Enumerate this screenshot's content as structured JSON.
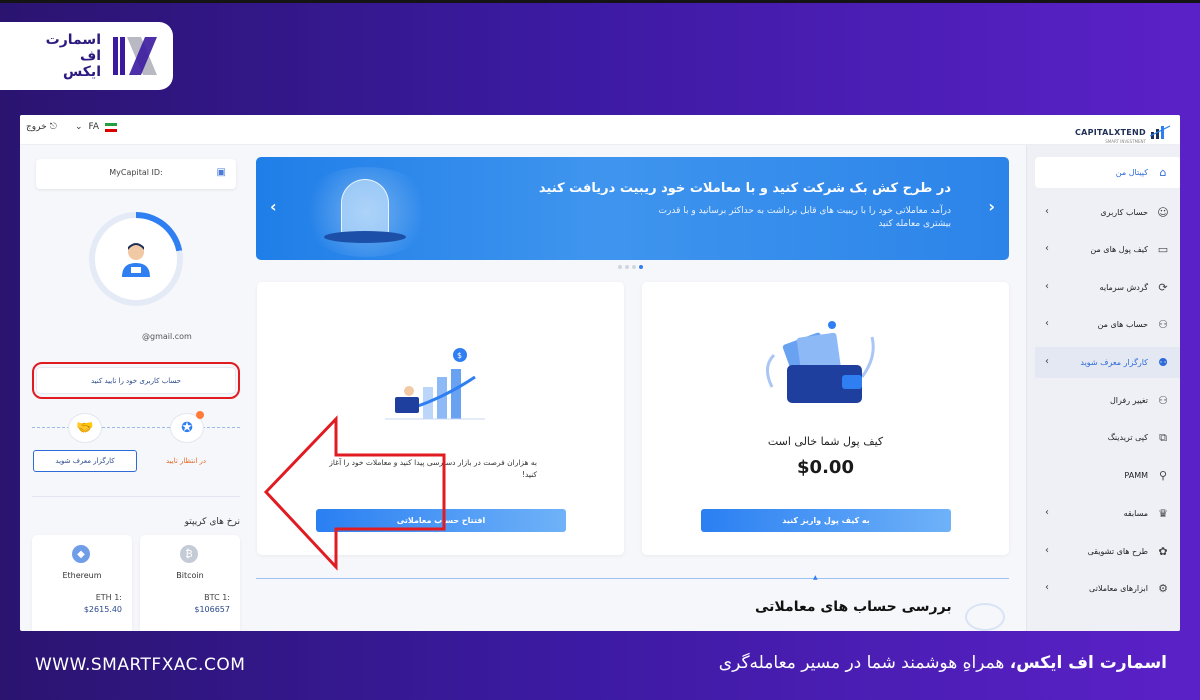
{
  "brand": {
    "line1": "اسمارت",
    "line2": "اف",
    "line3": "ایکس"
  },
  "topbar": {
    "logout": "خروج",
    "lang": "FA",
    "company": "CAPITALXTEND",
    "company_sub": "SMART INVESTMENT"
  },
  "profile": {
    "id_label": "MyCapital ID:",
    "email": "@gmail.com",
    "verify_text": "حساب کاربری خود را تایید کنید",
    "pending": "در انتظار تایید",
    "broker_button": "کارگزار معرف شوید"
  },
  "crypto": {
    "title": "نرخ های کریپتو",
    "coins": [
      {
        "name": "Bitcoin",
        "pair": "BTC 1:",
        "price": "$106657",
        "icon": "bitcoin-icon"
      },
      {
        "name": "Ethereum",
        "pair": "ETH 1:",
        "price": "$2615.40",
        "icon": "ethereum-icon"
      }
    ]
  },
  "banner": {
    "title": "در طرح کش بک شرکت کنید و با معاملات خود ریبیت دریافت کنید",
    "subtitle": "درآمد معاملاتی خود را با ریبیت های قابل برداشت به حداکثر برسانید و با قدرت بیشتری معامله کنید"
  },
  "wallet_card": {
    "title": "کیف پول شما خالی است",
    "amount": "$0.00",
    "button": "به کیف پول واریز کنید"
  },
  "trade_card": {
    "text": "به هزاران فرصت در بازار دسترسی پیدا کنید و معاملات خود را آغاز کنید!",
    "button": "افتتاح حساب معاملاتی"
  },
  "review": {
    "title": "بررسی حساب های معاملاتی"
  },
  "sidebar": {
    "items": [
      {
        "label": "کپیتال من",
        "icon": "home-icon",
        "chevron": false,
        "state": "active"
      },
      {
        "label": "حساب کاربری",
        "icon": "user-icon",
        "chevron": true,
        "state": ""
      },
      {
        "label": "کیف پول های من",
        "icon": "wallet-icon",
        "chevron": true,
        "state": ""
      },
      {
        "label": "گردش سرمایه",
        "icon": "money-flow-icon",
        "chevron": true,
        "state": ""
      },
      {
        "label": "حساب های من",
        "icon": "accounts-icon",
        "chevron": true,
        "state": ""
      },
      {
        "label": "کارگزار معرف شوید",
        "icon": "broker-icon",
        "chevron": true,
        "state": "highlight"
      },
      {
        "label": "تغییر رفرال",
        "icon": "referral-icon",
        "chevron": false,
        "state": ""
      },
      {
        "label": "کپی تریدینگ",
        "icon": "copy-trading-icon",
        "chevron": false,
        "state": ""
      },
      {
        "label": "PAMM",
        "icon": "pamm-icon",
        "chevron": false,
        "state": ""
      },
      {
        "label": "مسابقه",
        "icon": "trophy-icon",
        "chevron": true,
        "state": ""
      },
      {
        "label": "طرح های تشویقی",
        "icon": "gift-icon",
        "chevron": true,
        "state": ""
      },
      {
        "label": "ابزارهای معاملاتی",
        "icon": "tools-icon",
        "chevron": true,
        "state": ""
      }
    ]
  },
  "footer": {
    "url": "WWW.SMARTFXAC.COM",
    "tag_bold": "اسمارت اف ایکس،",
    "tag_rest": " همراهِ هوشمند شما در مسیر معامله‌گری"
  },
  "colors": {
    "accent": "#2f7ff2",
    "highlight_red": "#e11b22",
    "background_purple": "#3b1aa0"
  }
}
